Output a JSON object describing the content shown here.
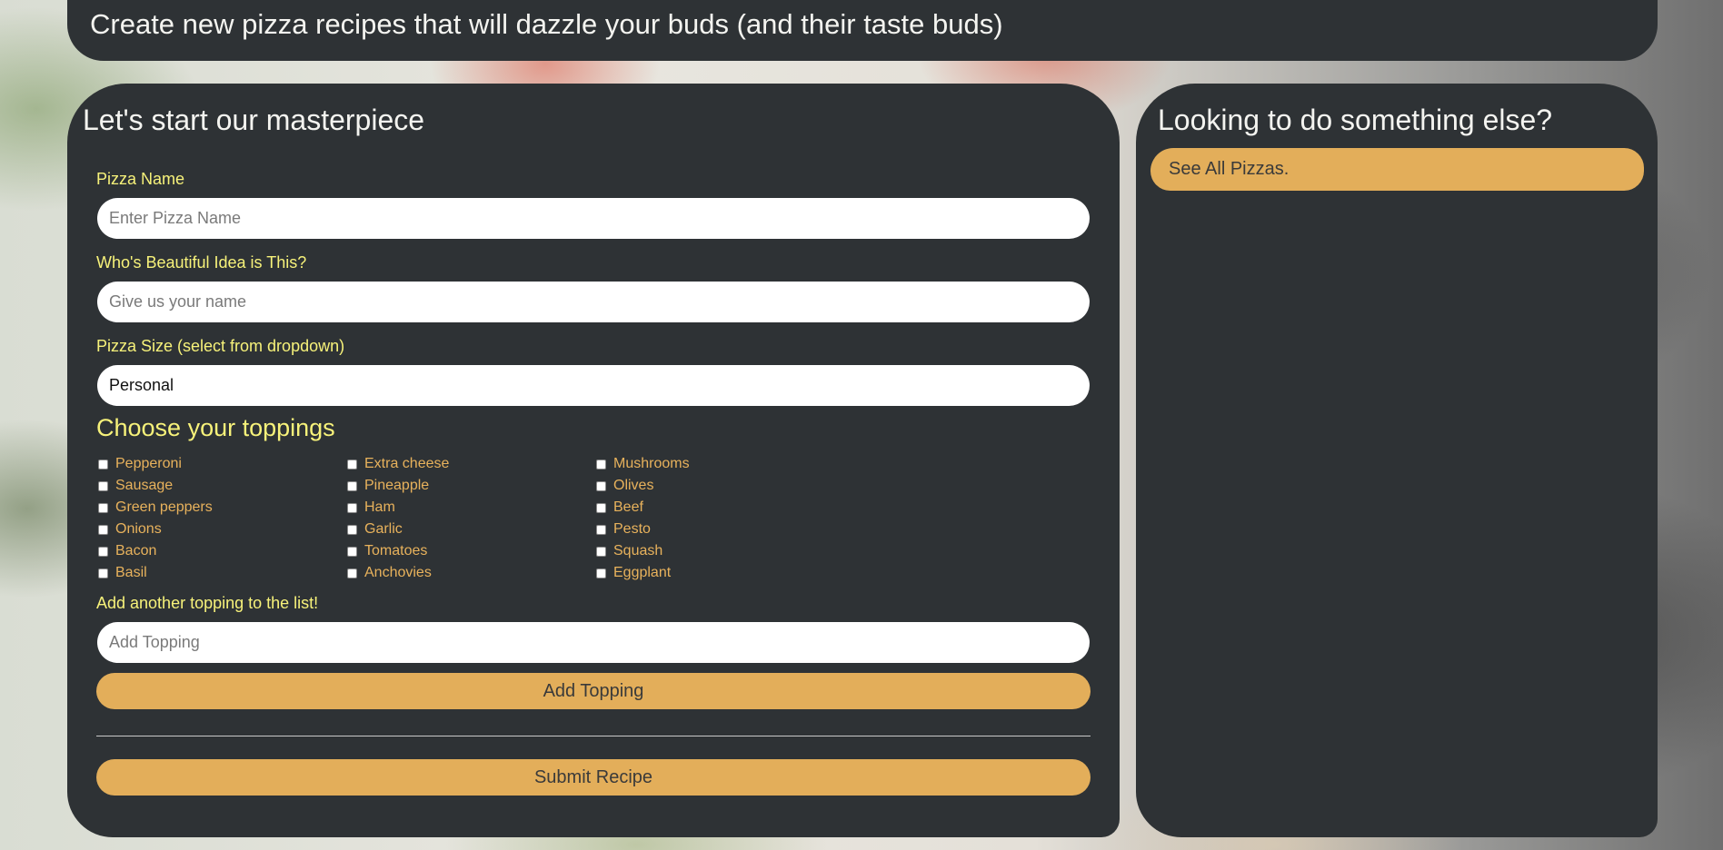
{
  "banner": {
    "title": "Create new pizza recipes that will dazzle your buds (and their taste buds)"
  },
  "form": {
    "title": "Let's start our masterpiece",
    "pizza_name": {
      "label": "Pizza Name",
      "placeholder": "Enter Pizza Name",
      "value": ""
    },
    "author": {
      "label": "Who's Beautiful Idea is This?",
      "placeholder": "Give us your name",
      "value": ""
    },
    "size": {
      "label": "Pizza Size (select from dropdown)",
      "selected": "Personal"
    },
    "toppings": {
      "heading": "Choose your toppings",
      "columns": [
        [
          "Pepperoni",
          "Sausage",
          "Green peppers",
          "Onions",
          "Bacon",
          "Basil"
        ],
        [
          "Extra cheese",
          "Pineapple",
          "Ham",
          "Garlic",
          "Tomatoes",
          "Anchovies"
        ],
        [
          "Mushrooms",
          "Olives",
          "Beef",
          "Pesto",
          "Squash",
          "Eggplant"
        ]
      ]
    },
    "new_topping": {
      "label": "Add another topping to the list!",
      "placeholder": "Add Topping",
      "value": ""
    },
    "add_topping_button": "Add Topping",
    "submit_button": "Submit Recipe"
  },
  "sidebar": {
    "title": "Looking to do something else?",
    "link": "See All Pizzas."
  },
  "colors": {
    "panel_bg": "#2e3235",
    "label_yellow": "#f7f27a",
    "topping_orange": "#e8b25c",
    "button_gold": "#e3ae5a"
  }
}
